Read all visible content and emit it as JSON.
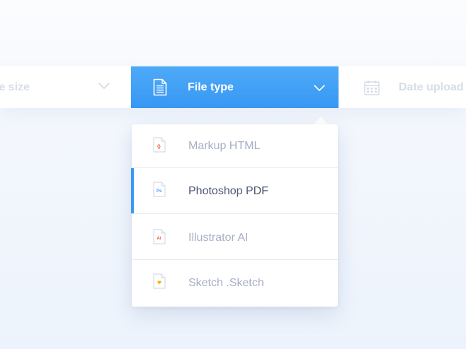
{
  "filter_bar": {
    "size_label": "le size",
    "type_label": "File type",
    "date_label": "Date upload"
  },
  "dropdown": {
    "items": [
      {
        "label": "Markup HTML",
        "icon": "html-file-icon",
        "tag": "{}",
        "tag_color": "#e4543b"
      },
      {
        "label": "Photoshop PDF",
        "icon": "photoshop-file-icon",
        "tag": "Ps",
        "tag_color": "#3a99f4",
        "selected": true
      },
      {
        "label": "Illustrator AI",
        "icon": "illustrator-file-icon",
        "tag": "Ai",
        "tag_color": "#e4543b"
      },
      {
        "label": "Sketch .Sketch",
        "icon": "sketch-file-icon",
        "tag": "",
        "tag_color": "#f5b400"
      }
    ]
  },
  "colors": {
    "accent": "#3a99f4",
    "muted_text": "#a7b0c4",
    "selected_text": "#4d5670",
    "inactive_filter_text": "#d7dde7"
  }
}
